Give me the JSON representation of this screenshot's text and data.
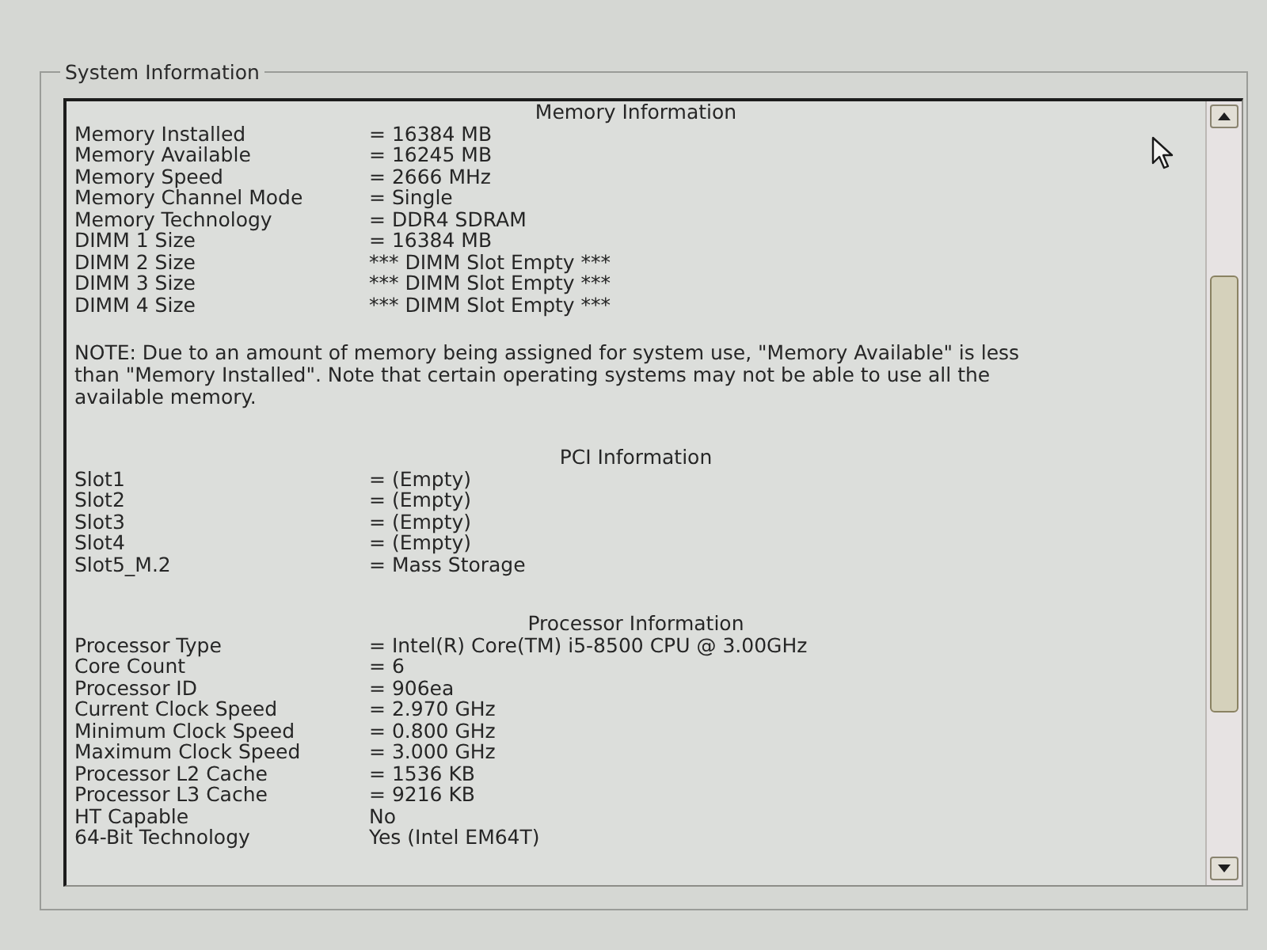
{
  "window": {
    "title": "System Information"
  },
  "sections": [
    {
      "heading": "Memory Information",
      "rows": [
        {
          "label": "Memory Installed",
          "value": "= 16384 MB"
        },
        {
          "label": "Memory Available",
          "value": "= 16245 MB"
        },
        {
          "label": "Memory Speed",
          "value": "= 2666 MHz"
        },
        {
          "label": "Memory Channel Mode",
          "value": "= Single"
        },
        {
          "label": "Memory Technology",
          "value": "= DDR4 SDRAM"
        },
        {
          "label": "DIMM 1 Size",
          "value": "= 16384 MB"
        },
        {
          "label": "DIMM 2 Size",
          "value": "*** DIMM Slot Empty ***"
        },
        {
          "label": "DIMM 3 Size",
          "value": "*** DIMM Slot Empty ***"
        },
        {
          "label": "DIMM 4 Size",
          "value": "*** DIMM Slot Empty ***"
        }
      ],
      "note": "NOTE: Due to an amount of memory being assigned for system use, \"Memory Available\" is less than \"Memory Installed\". Note that certain operating systems may not be able to use all the available memory."
    },
    {
      "heading": "PCI Information",
      "rows": [
        {
          "label": "Slot1",
          "value": "= (Empty)"
        },
        {
          "label": "Slot2",
          "value": "= (Empty)"
        },
        {
          "label": "Slot3",
          "value": "= (Empty)"
        },
        {
          "label": "Slot4",
          "value": "= (Empty)"
        },
        {
          "label": "Slot5_M.2",
          "value": "= Mass Storage"
        }
      ]
    },
    {
      "heading": "Processor Information",
      "rows": [
        {
          "label": "Processor Type",
          "value": "= Intel(R) Core(TM) i5-8500 CPU @ 3.00GHz"
        },
        {
          "label": "Core Count",
          "value": "= 6"
        },
        {
          "label": "Processor ID",
          "value": "= 906ea"
        },
        {
          "label": "Current Clock Speed",
          "value": "= 2.970 GHz"
        },
        {
          "label": "Minimum Clock Speed",
          "value": "= 0.800 GHz"
        },
        {
          "label": "Maximum Clock Speed",
          "value": "= 3.000 GHz"
        },
        {
          "label": "Processor L2 Cache",
          "value": "= 1536 KB"
        },
        {
          "label": "Processor L3 Cache",
          "value": "= 9216 KB"
        },
        {
          "label": "HT Capable",
          "value": "No"
        },
        {
          "label": "64-Bit Technology",
          "value": "Yes (Intel EM64T)"
        }
      ]
    }
  ]
}
